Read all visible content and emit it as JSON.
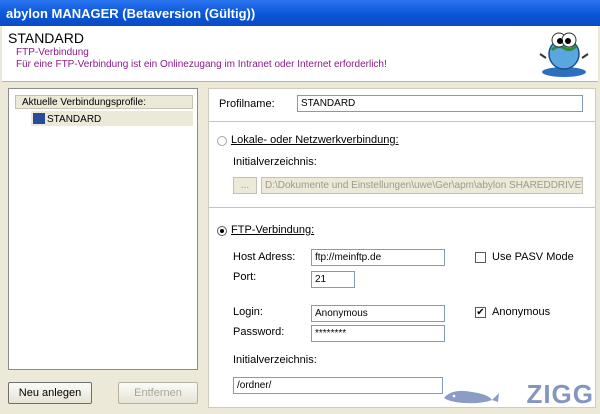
{
  "window": {
    "title": "abylon MANAGER (Betaversion (Gültig))"
  },
  "header": {
    "title": "STANDARD",
    "subtitle": "FTP-Verbindung",
    "description": "Für eine FTP-Verbindung ist ein Onlinezugang im Intranet oder Internet erforderlich!",
    "logo_icon": "globe-mascot-icon"
  },
  "profiles": {
    "header": "Aktuelle Verbindungsprofile:",
    "items": [
      {
        "label": "STANDARD",
        "icon": "profile-icon"
      }
    ],
    "new_button": "Neu anlegen",
    "remove_button": "Entfernen"
  },
  "form": {
    "profile_label": "Profilname:",
    "profile_value": "STANDARD",
    "local": {
      "option_label": "Lokale- oder Netzwerkverbindung:",
      "selected": false,
      "dir_label": "Initialverzeichnis:",
      "browse_button": "...",
      "dir_value": "D:\\Dokumente und Einstellungen\\uwe\\Ger\\apm\\abylon SHAREDDRIVE\\STAND"
    },
    "ftp": {
      "option_label": "FTP-Verbindung:",
      "selected": true,
      "host_label": "Host Adress:",
      "host_value": "ftp://meinftp.de",
      "pasv_label": "Use PASV Mode",
      "pasv_checked": false,
      "port_label": "Port:",
      "port_value": "21",
      "login_label": "Login:",
      "login_value": "Anonymous",
      "anonymous_label": "Anonymous",
      "anonymous_checked": true,
      "password_label": "Password:",
      "password_value": "********",
      "dir_label": "Initialverzeichnis:",
      "dir_value": "/ordner/"
    }
  },
  "watermark": {
    "text": "ZIGG"
  }
}
